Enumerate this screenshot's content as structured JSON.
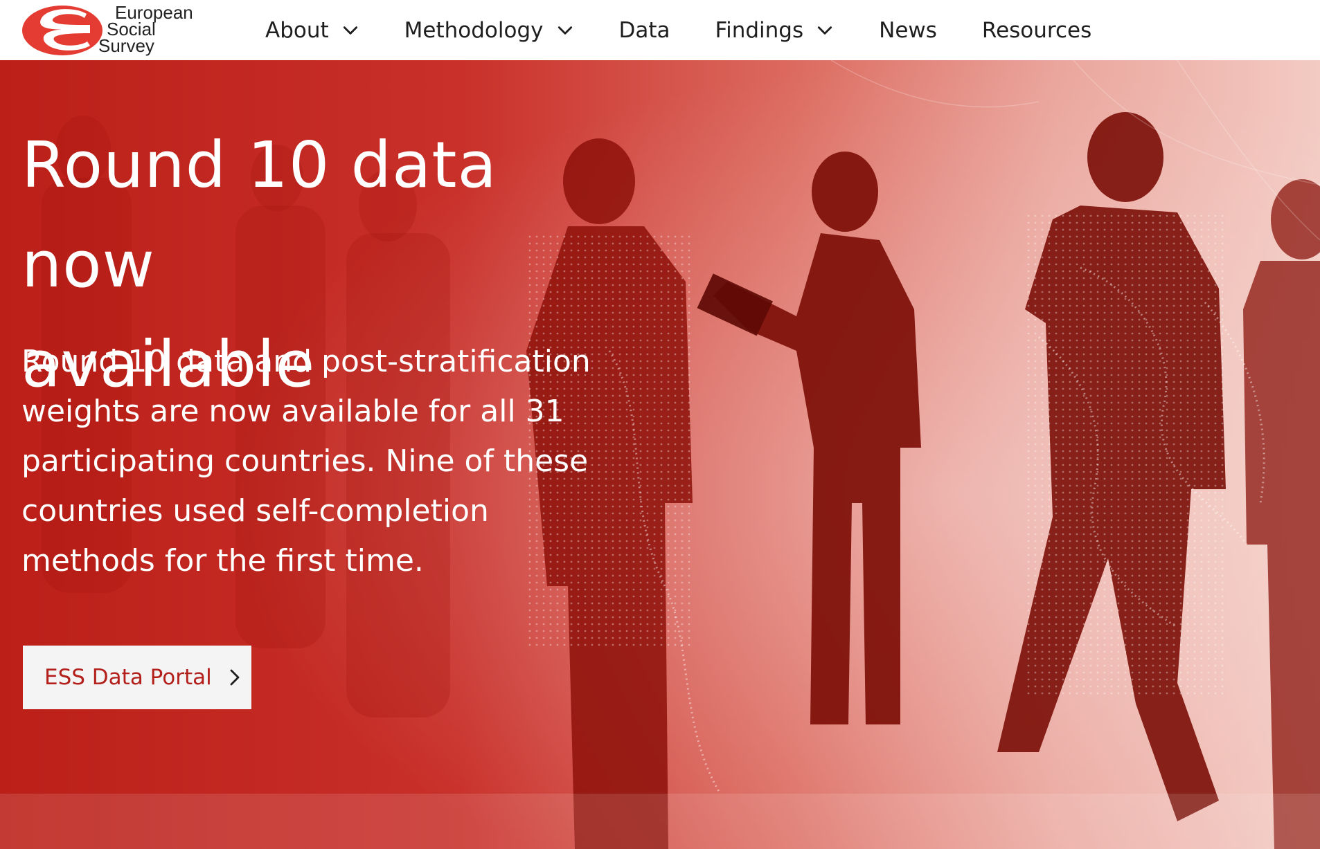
{
  "brand": {
    "name_lines": [
      "European",
      "Social",
      "Survey"
    ],
    "accent": "#e43c32",
    "hero_red": "#c0261e"
  },
  "nav": {
    "items": [
      {
        "label": "About",
        "has_dropdown": true
      },
      {
        "label": "Methodology",
        "has_dropdown": true
      },
      {
        "label": "Data",
        "has_dropdown": false
      },
      {
        "label": "Findings",
        "has_dropdown": true
      },
      {
        "label": "News",
        "has_dropdown": false
      },
      {
        "label": "Resources",
        "has_dropdown": false
      }
    ]
  },
  "hero": {
    "headline_line1": "Round 10 data now",
    "headline_line2": "available",
    "lede_lines": [
      "Round 10 data and post-stratification",
      "weights are now available for all 31",
      "participating countries. Nine of these",
      "countries used self-completion",
      "methods for the first time."
    ],
    "cta_label": "ESS Data Portal",
    "cta_icon": "chevron-right-icon"
  }
}
